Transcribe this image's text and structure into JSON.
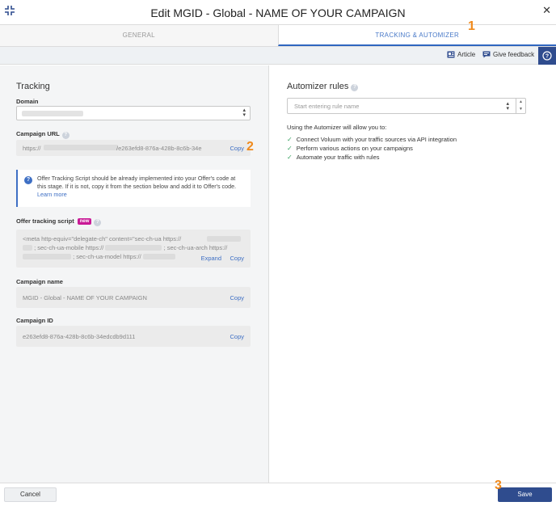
{
  "dialog": {
    "title": "Edit MGID - Global - NAME OF YOUR CAMPAIGN"
  },
  "tabs": [
    {
      "label": "GENERAL",
      "active": false
    },
    {
      "label": "TRACKING & AUTOMIZER",
      "active": true
    }
  ],
  "toolbar": {
    "article": "Article",
    "feedback": "Give feedback",
    "help": "?"
  },
  "tracking": {
    "heading": "Tracking",
    "domain_label": "Domain",
    "campaign_url_label": "Campaign URL",
    "campaign_url_prefix": "https://",
    "campaign_url_suffix": "/e263efd8-876a-428b-8c6b-34e",
    "copy": "Copy",
    "info_text": "Offer Tracking Script should be already implemented into your Offer's code at this stage. If it is not, copy it from the section below and add it to Offer's code.",
    "info_link": "Learn more",
    "offer_script_label": "Offer tracking script",
    "new_badge": "new",
    "script_line1": "<meta http-equiv=\"delegate-ch\" content=\"sec-ch-ua https://",
    "script_line2a": "; sec-ch-ua-mobile https://",
    "script_line2b": "; sec-ch-ua-arch https://",
    "script_line3": "; sec-ch-ua-model https://",
    "expand": "Expand",
    "campaign_name_label": "Campaign name",
    "campaign_name_value": "MGID - Global - NAME OF YOUR CAMPAIGN",
    "campaign_id_label": "Campaign ID",
    "campaign_id_value": "e263efd8-876a-428b-8c6b-34edcdb9d111"
  },
  "automizer": {
    "heading": "Automizer rules",
    "placeholder": "Start entering rule name",
    "intro": "Using the Automizer will allow you to:",
    "items": [
      "Connect Voluum with your traffic sources via API integration",
      "Perform various actions on your campaigns",
      "Automate your traffic with rules"
    ]
  },
  "footer": {
    "cancel": "Cancel",
    "save": "Save"
  },
  "callouts": [
    "1",
    "2",
    "3"
  ],
  "colors": {
    "accent": "#2f4c8e",
    "link": "#3e6fc4",
    "badge": "#c91a96",
    "callout": "#f08a1c"
  }
}
